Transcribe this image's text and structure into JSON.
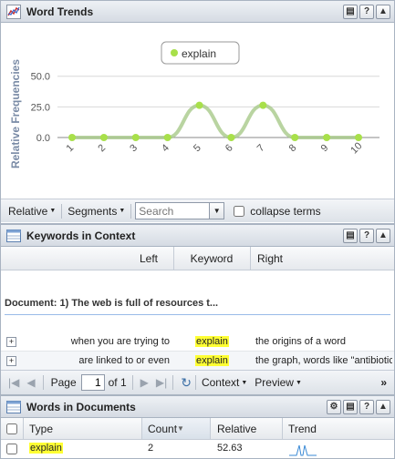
{
  "word_trends": {
    "title": "Word Trends",
    "ylabel": "Relative Frequencies",
    "legend": "explain",
    "toolbar": {
      "relative": "Relative",
      "segments": "Segments",
      "search_placeholder": "Search",
      "collapse": "collapse terms"
    }
  },
  "chart_data": {
    "type": "line",
    "title": "",
    "xlabel": "",
    "ylabel": "Relative Frequencies",
    "categories": [
      "1",
      "2",
      "3",
      "4",
      "5",
      "6",
      "7",
      "8",
      "9",
      "10"
    ],
    "series": [
      {
        "name": "explain",
        "values": [
          0,
          0,
          0,
          0,
          26.3,
          0,
          26.3,
          0,
          0,
          0
        ]
      }
    ],
    "y_ticks": [
      "0.0",
      "25.0",
      "50.0"
    ],
    "ylim": [
      0,
      55
    ],
    "legend_position": "top",
    "colors": {
      "line": "#a8c98a",
      "point": "#a8e04a"
    }
  },
  "kwic": {
    "title": "Keywords in Context",
    "columns": [
      "Left",
      "Keyword",
      "Right"
    ],
    "group_label": "Document: 1) The web is full of resources t...",
    "rows": [
      {
        "left": "when you are trying to",
        "keyword": "explain",
        "right": "the origins of a word"
      },
      {
        "left": "are linked to or even",
        "keyword": "explain",
        "right": "the graph, words like \"antibiotic"
      }
    ],
    "pager": {
      "page_label": "Page",
      "page_value": "1",
      "of_label": "of 1",
      "context": "Context",
      "preview": "Preview"
    }
  },
  "words": {
    "title": "Words in Documents",
    "columns": [
      "Type",
      "Count",
      "Relative",
      "Trend"
    ],
    "rows": [
      {
        "type": "explain",
        "count": "2",
        "relative": "52.63"
      }
    ]
  }
}
